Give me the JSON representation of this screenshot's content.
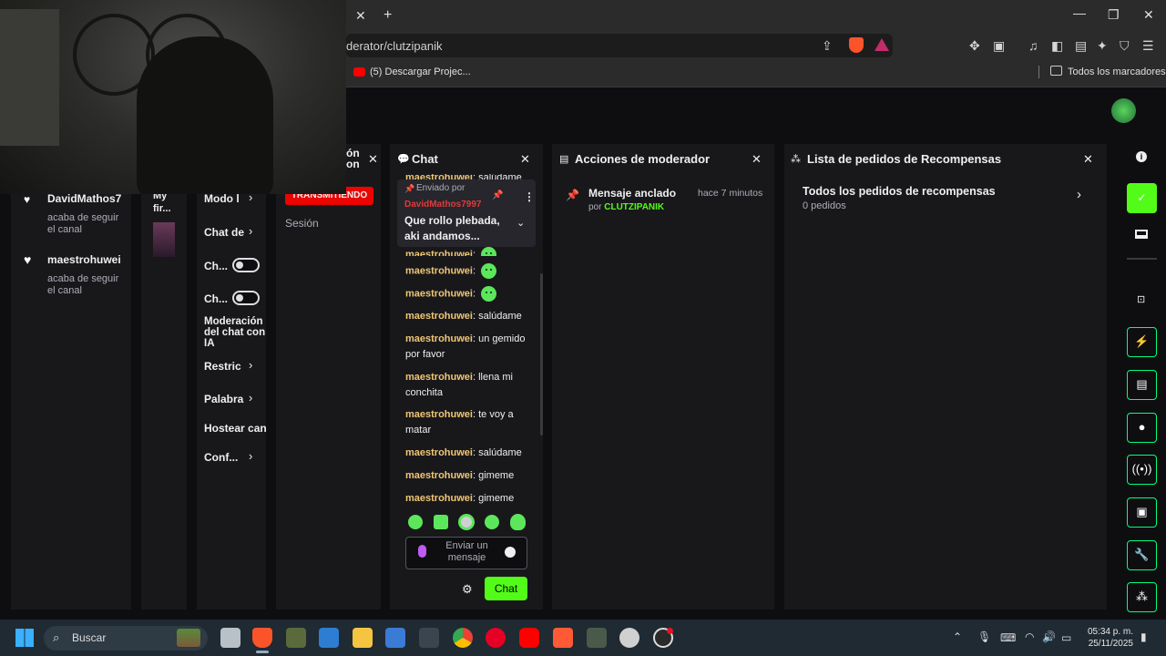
{
  "browser": {
    "url": "derator/clutzipanik",
    "bookmark_youtube": "(5) Descargar Projec...",
    "bookmarks_all": "Todos los marcadores",
    "tab_close": "✕",
    "new_tab": "+"
  },
  "activity": {
    "items": [
      {
        "user": "DavidMathos7",
        "text": "acaba de seguir el canal"
      },
      {
        "user": "maestrohuwei",
        "text": "acaba de seguir el canal"
      }
    ]
  },
  "col2": {
    "title_short": "My fir..."
  },
  "settings": {
    "items": [
      "Modo l",
      "Chat de",
      "Ch...",
      "Ch...",
      "Moderación del chat con IA",
      "Restric",
      "Palabra",
      "Hostear can",
      "Conf..."
    ]
  },
  "stream": {
    "partial_title": "ón on",
    "badge": "TRANSMITIENDO",
    "session": "Sesión"
  },
  "chat": {
    "title": "Chat",
    "pinned_label": "Enviado por",
    "pinned_by": "DavidMathos7997",
    "pinned_text": "Que rollo plebada, aki andamos...",
    "top_partial_user": "maestrohuwei",
    "top_partial_text": "salúdame",
    "messages": [
      {
        "user": "maestrohuwei",
        "text": ""
      },
      {
        "user": "maestrohuwei",
        "text": ""
      },
      {
        "user": "maestrohuwei",
        "text": ""
      },
      {
        "user": "maestrohuwei",
        "text": "salúdame"
      },
      {
        "user": "maestrohuwei",
        "text": "un gemido por favor"
      },
      {
        "user": "maestrohuwei",
        "text": "llena mi conchita"
      },
      {
        "user": "maestrohuwei",
        "text": "te voy a matar"
      },
      {
        "user": "maestrohuwei",
        "text": "salúdame"
      },
      {
        "user": "maestrohuwei",
        "text": "gimeme"
      },
      {
        "user": "maestrohuwei",
        "text": "gimeme"
      }
    ],
    "input_placeholder": "Enviar un mensaje",
    "send_label": "Chat"
  },
  "modactions": {
    "title": "Acciones de moderador",
    "item_title": "Mensaje anclado",
    "item_by_prefix": "por",
    "item_by": "CLUTZIPANIK",
    "item_time": "hace 7 minutos"
  },
  "rewards": {
    "title": "Lista de pedidos de Recompensas",
    "all_title": "Todos los pedidos de recompensas",
    "count": "0 pedidos"
  },
  "taskbar": {
    "search": "Buscar",
    "time": "05:34 p. m.",
    "date": "25/11/2025"
  },
  "colors": {
    "accent": "#53fc18",
    "username": "#f0c674",
    "live": "#eb0400"
  }
}
